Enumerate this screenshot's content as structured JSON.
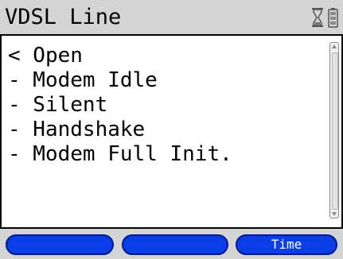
{
  "header": {
    "title": "VDSL Line",
    "status_icons": [
      "hourglass-icon",
      "battery-icon"
    ]
  },
  "menu": {
    "items": [
      {
        "label": "< Open"
      },
      {
        "label": "- Modem Idle"
      },
      {
        "label": "- Silent"
      },
      {
        "label": "- Handshake"
      },
      {
        "label": "- Modem Full Init."
      }
    ]
  },
  "softkeys": [
    {
      "label": ""
    },
    {
      "label": ""
    },
    {
      "label": "Time"
    }
  ],
  "colors": {
    "title_bar": "#d4d4d4",
    "softkey_fill": "#0a3ee6",
    "softkey_text": "#ffffff"
  }
}
